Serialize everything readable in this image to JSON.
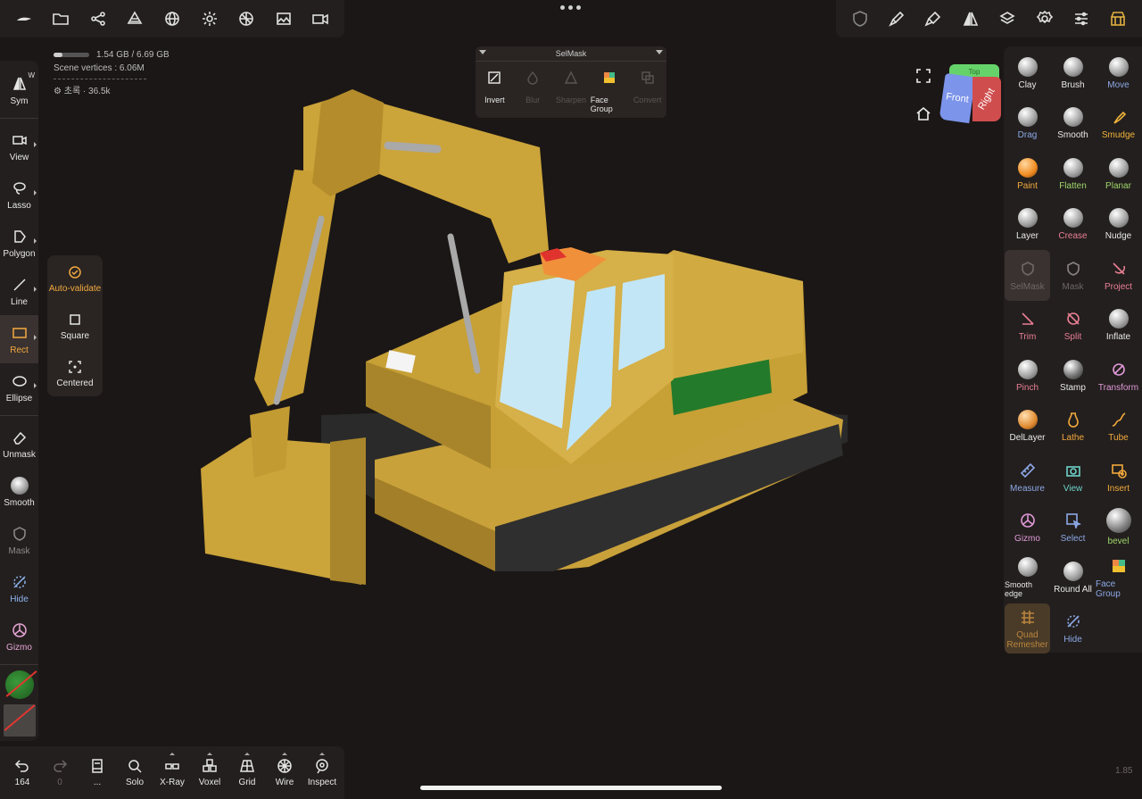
{
  "top_left_icons": [
    "logo-icon",
    "folder-icon",
    "share-icon",
    "scene-icon",
    "wireframe-sphere-icon",
    "sun-icon",
    "material-icon",
    "image-icon",
    "camera-icon"
  ],
  "top_right_icons": [
    "selmask-icon",
    "brush-icon",
    "picker-icon",
    "symmetry-icon",
    "layers-icon",
    "settings-icon",
    "sliders-icon",
    "shop-icon"
  ],
  "stats": {
    "memory": "1.54 GB / 6.69 GB",
    "vertices": "Scene vertices : 6.06M",
    "object": "초록 · 36.5k"
  },
  "left_tools": [
    {
      "label": "Sym",
      "sup": "W"
    },
    {
      "label": "View"
    },
    {
      "label": "Lasso"
    },
    {
      "label": "Polygon"
    },
    {
      "label": "Line"
    },
    {
      "label": "Rect"
    },
    {
      "label": "Ellipse"
    },
    {
      "label": "Unmask"
    },
    {
      "label": "Smooth"
    },
    {
      "label": "Mask"
    },
    {
      "label": "Hide"
    },
    {
      "label": "Gizmo"
    }
  ],
  "sub_panel": [
    {
      "label": "Auto-validate"
    },
    {
      "label": "Square"
    },
    {
      "label": "Centered"
    }
  ],
  "selmask": {
    "title": "SelMask",
    "items": [
      {
        "label": "Invert"
      },
      {
        "label": "Blur"
      },
      {
        "label": "Sharpen"
      },
      {
        "label": "Face Group"
      },
      {
        "label": "Convert"
      }
    ]
  },
  "right_tools": [
    {
      "label": "Clay"
    },
    {
      "label": "Brush"
    },
    {
      "label": "Move"
    },
    {
      "label": "Drag"
    },
    {
      "label": "Smooth"
    },
    {
      "label": "Smudge"
    },
    {
      "label": "Paint"
    },
    {
      "label": "Flatten"
    },
    {
      "label": "Planar"
    },
    {
      "label": "Layer"
    },
    {
      "label": "Crease"
    },
    {
      "label": "Nudge"
    },
    {
      "label": "SelMask"
    },
    {
      "label": "Mask"
    },
    {
      "label": "Project"
    },
    {
      "label": "Trim"
    },
    {
      "label": "Split"
    },
    {
      "label": "Inflate"
    },
    {
      "label": "Pinch"
    },
    {
      "label": "Stamp"
    },
    {
      "label": "Transform"
    },
    {
      "label": "DelLayer"
    },
    {
      "label": "Lathe"
    },
    {
      "label": "Tube"
    },
    {
      "label": "Measure"
    },
    {
      "label": "View"
    },
    {
      "label": "Insert"
    },
    {
      "label": "Gizmo"
    },
    {
      "label": "Select"
    },
    {
      "label": "bevel"
    },
    {
      "label": "Smooth edge"
    },
    {
      "label": "Round All"
    },
    {
      "label": "Face Group"
    },
    {
      "label": "Quad Remesher"
    },
    {
      "label": "Hide"
    }
  ],
  "cube": {
    "front": "Front",
    "right": "Right",
    "top": "Top"
  },
  "bottom_tools": [
    {
      "label": "164"
    },
    {
      "label": "0"
    },
    {
      "label": "..."
    },
    {
      "label": "Solo"
    },
    {
      "label": "X-Ray"
    },
    {
      "label": "Voxel"
    },
    {
      "label": "Grid"
    },
    {
      "label": "Wire"
    },
    {
      "label": "Inspect"
    }
  ],
  "version": "1.85",
  "colors": {
    "accent": "#f3a940",
    "background": "#1b1716",
    "panel": "#231f1e"
  }
}
